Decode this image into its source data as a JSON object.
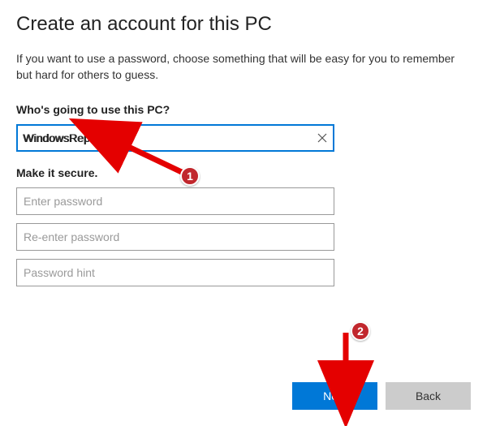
{
  "title": "Create an account for this PC",
  "description": "If you want to use a password, choose something that will be easy for you to remember but hard for others to guess.",
  "section1": {
    "label": "Who's going to use this PC?",
    "username_value": "WindowsReport"
  },
  "section2": {
    "label": "Make it secure.",
    "password_placeholder": "Enter password",
    "reenter_placeholder": "Re-enter password",
    "hint_placeholder": "Password hint"
  },
  "buttons": {
    "next": "Next",
    "back": "Back"
  },
  "annotations": {
    "step1": "1",
    "step2": "2"
  }
}
